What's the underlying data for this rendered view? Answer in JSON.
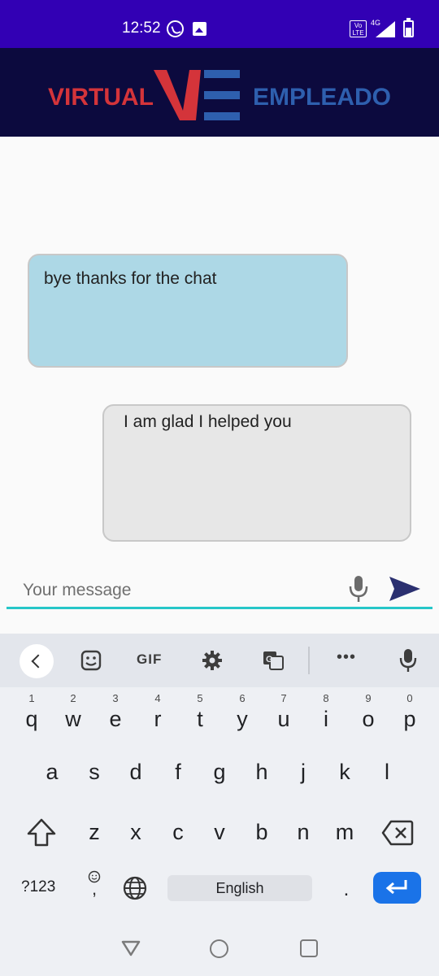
{
  "status_bar": {
    "time": "12:52",
    "volte_label": "Vo LTE",
    "network_label": "4G",
    "icons": [
      "whatsapp-icon",
      "image-icon",
      "volte-icon",
      "signal-icon",
      "battery-icon"
    ]
  },
  "header": {
    "logo_left": "VIRTUAL",
    "logo_right": "EMPLEADO",
    "colors": {
      "background": "#0c0a3e",
      "logo_red": "#d4343a",
      "logo_blue": "#2e5fae"
    }
  },
  "chat": {
    "messages": [
      {
        "sender": "user",
        "text": "bye thanks for the chat",
        "color": "#add8e6"
      },
      {
        "sender": "bot",
        "text": "I am glad I helped you",
        "color": "#e7e7e7"
      }
    ]
  },
  "composer": {
    "placeholder": "Your message",
    "value": "",
    "accent": "#26c6c8",
    "mic_icon": "mic-icon",
    "send_icon": "send-icon"
  },
  "keyboard": {
    "toolbar": {
      "gif_label": "GIF",
      "more_label": "•••",
      "icons": [
        "chevron-left-icon",
        "sticker-icon",
        "gear-icon",
        "translate-icon",
        "mic-icon"
      ]
    },
    "row1": [
      {
        "hint": "1",
        "key": "q"
      },
      {
        "hint": "2",
        "key": "w"
      },
      {
        "hint": "3",
        "key": "e"
      },
      {
        "hint": "4",
        "key": "r"
      },
      {
        "hint": "5",
        "key": "t"
      },
      {
        "hint": "6",
        "key": "y"
      },
      {
        "hint": "7",
        "key": "u"
      },
      {
        "hint": "8",
        "key": "i"
      },
      {
        "hint": "9",
        "key": "o"
      },
      {
        "hint": "0",
        "key": "p"
      }
    ],
    "row2": [
      "a",
      "s",
      "d",
      "f",
      "g",
      "h",
      "j",
      "k",
      "l"
    ],
    "row3": [
      "z",
      "x",
      "c",
      "v",
      "b",
      "n",
      "m"
    ],
    "num_label": "?123",
    "comma_label": ",",
    "space_label": "English",
    "period_label": ".",
    "enter_color": "#1a73e8"
  },
  "nav_bar": {
    "icons": [
      "back-triangle-icon",
      "home-circle-icon",
      "recents-square-icon"
    ]
  }
}
